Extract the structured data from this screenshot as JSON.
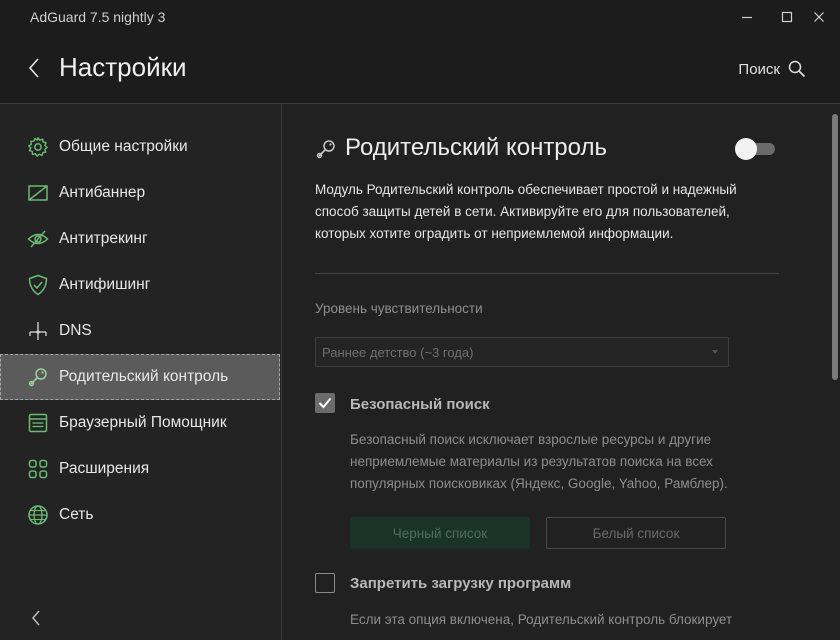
{
  "window": {
    "title": "AdGuard 7.5 nightly 3",
    "controls": [
      "minimize-icon",
      "maximize-icon",
      "close-icon"
    ]
  },
  "header": {
    "back_icon": "chevron-left-icon",
    "title": "Настройки",
    "search_label": "Поиск",
    "search_icon": "search-icon"
  },
  "sidebar": {
    "items": [
      {
        "label": "Общие настройки",
        "icon": "gear-icon"
      },
      {
        "label": "Антибаннер",
        "icon": "no-ads-icon"
      },
      {
        "label": "Антитрекинг",
        "icon": "eye-off-icon"
      },
      {
        "label": "Антифишинг",
        "icon": "shield-check-icon"
      },
      {
        "label": "DNS",
        "icon": "dns-network-icon"
      },
      {
        "label": "Родительский контроль",
        "icon": "parental-rattle-icon",
        "active": true
      },
      {
        "label": "Браузерный Помощник",
        "icon": "browser-window-icon"
      },
      {
        "label": "Расширения",
        "icon": "extensions-grid-icon"
      },
      {
        "label": "Сеть",
        "icon": "globe-icon"
      }
    ],
    "collapse_icon": "chevron-left-icon"
  },
  "content": {
    "title": "Родительский контроль",
    "title_icon": "parental-rattle-icon",
    "enabled": false,
    "description_lines": [
      "Модуль Родительский контроль обеспечивает простой и надежный",
      "способ защиты детей в сети. Активируйте его для пользователей,",
      "которых хотите оградить от неприемлемой информации."
    ],
    "sensitivity": {
      "label": "Уровень чувствительности",
      "selected": "Раннее детство (~3 года)"
    },
    "safe_search": {
      "checked": true,
      "title": "Безопасный поиск",
      "description_lines": [
        "Безопасный поиск исключает взрослые ресурсы и другие",
        "неприемлемые материалы из результатов поиска на всех",
        "популярных поисковиках (Яндекс, Google, Yahoo, Рамблер)."
      ],
      "blacklist_button": "Черный список",
      "whitelist_button": "Белый список"
    },
    "block_downloads": {
      "checked": false,
      "title": "Запретить загрузку программ",
      "description_lines": [
        "Если эта опция включена, Родительский контроль блокирует"
      ]
    }
  },
  "colors": {
    "accent": "#68bc71",
    "background": "#212121",
    "sidebar_active": "#5b5b5b"
  }
}
